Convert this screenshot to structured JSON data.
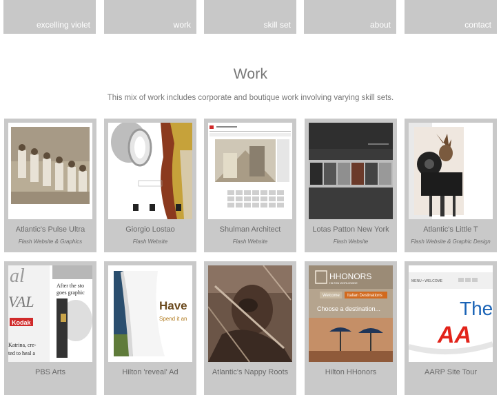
{
  "nav": {
    "items": [
      {
        "label": "excelling violet"
      },
      {
        "label": "work"
      },
      {
        "label": "skill set"
      },
      {
        "label": "about"
      },
      {
        "label": "contact"
      }
    ]
  },
  "page": {
    "title": "Work",
    "intro": "This mix of work includes corporate and boutique work involving varying skill sets."
  },
  "portfolio": {
    "items": [
      {
        "title": "Atlantic's Pulse Ultra",
        "subtitle": "Flash Website & Graphics"
      },
      {
        "title": "Giorgio Lostao",
        "subtitle": "Flash Website"
      },
      {
        "title": "Shulman Architect",
        "subtitle": "Flash Website"
      },
      {
        "title": "Lotas Patton New York",
        "subtitle": "Flash Website"
      },
      {
        "title": "Atlantic's Little T",
        "subtitle": "Flash Website & Graphic Design"
      },
      {
        "title": "PBS Arts",
        "subtitle": ""
      },
      {
        "title": "Hilton 'reveal' Ad",
        "subtitle": ""
      },
      {
        "title": "Atlantic's Nappy Roots",
        "subtitle": ""
      },
      {
        "title": "Hilton HHonors",
        "subtitle": ""
      },
      {
        "title": "AARP Site Tour",
        "subtitle": ""
      }
    ]
  },
  "thumb_text": {
    "pbs_big": "al",
    "pbs_val": "VAL",
    "pbs_kodak": "Kodak",
    "pbs_after": "After the sto",
    "pbs_goes": "goes graphic",
    "pbs_katrina": "Katrina, cre-",
    "pbs_ted": "ted to heal a",
    "hilton_have": "Have",
    "hilton_spend": "Spend it an",
    "hhonors_logo": "HHONORS",
    "hhonors_sub": "HILTON WORLDWIDE",
    "hhonors_welcome": "Welcome",
    "hhonors_italian": "Italian Destinations",
    "hhonors_choose": "Choose a destination...",
    "aarp_the": "The",
    "aarp_aa": "AA",
    "aarp_menu": "MENU • WELCOME"
  },
  "colors": {
    "nav_bg": "#c8c8c8",
    "card_bg": "#c9c9c9",
    "text": "#777777",
    "aarp_red": "#e2231a",
    "aarp_blue": "#1a63b6"
  }
}
